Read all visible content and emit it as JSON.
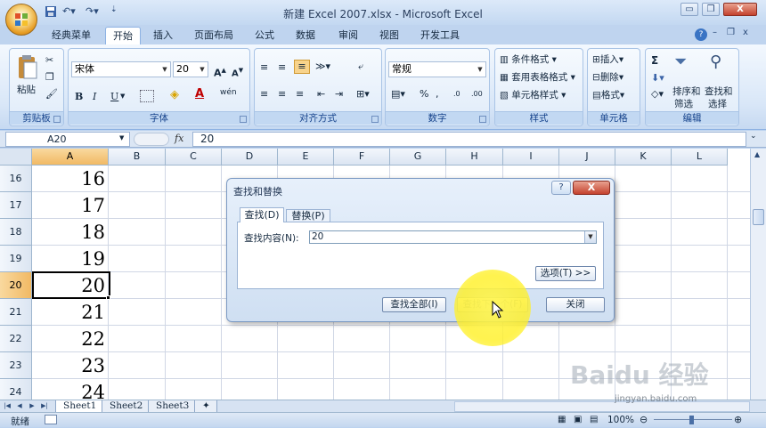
{
  "window": {
    "title": "新建 Excel 2007.xlsx - Microsoft Excel",
    "controls": [
      "minimize",
      "restore",
      "close"
    ]
  },
  "ribbon_tabs": [
    "经典菜单",
    "开始",
    "插入",
    "页面布局",
    "公式",
    "数据",
    "审阅",
    "视图",
    "开发工具"
  ],
  "active_tab": "开始",
  "ribbon": {
    "clipboard": {
      "paste": "粘贴",
      "label": "剪贴板"
    },
    "font": {
      "name": "宋体",
      "size": "20",
      "grow": "A",
      "shrink": "A",
      "bold": "B",
      "italic": "I",
      "underline": "U",
      "phonetic": "wén",
      "label": "字体"
    },
    "alignment": {
      "label": "对齐方式"
    },
    "number": {
      "format": "常规",
      "percent": "%",
      "comma": ",",
      "label": "数字",
      "inc_decimal": ".0",
      "dec_decimal": ".00"
    },
    "styles": {
      "conditional": "条件格式",
      "table": "套用表格格式",
      "cell_styles": "单元格样式",
      "label": "样式"
    },
    "cells": {
      "insert": "插入",
      "delete": "删除",
      "format": "格式",
      "label": "单元格"
    },
    "editing": {
      "sigma": "Σ",
      "sort": "排序和",
      "sort2": "筛选",
      "find": "查找和",
      "find2": "选择",
      "label": "编辑"
    }
  },
  "formula_bar": {
    "name_box": "A20",
    "fx": "fx",
    "value": "20"
  },
  "columns": [
    "A",
    "B",
    "C",
    "D",
    "E",
    "F",
    "G",
    "H",
    "I",
    "J",
    "K",
    "L"
  ],
  "selected_column": "A",
  "rows": [
    {
      "num": "16",
      "a": "16"
    },
    {
      "num": "17",
      "a": "17"
    },
    {
      "num": "18",
      "a": "18"
    },
    {
      "num": "19",
      "a": "19"
    },
    {
      "num": "20",
      "a": "20"
    },
    {
      "num": "21",
      "a": "21"
    },
    {
      "num": "22",
      "a": "22"
    },
    {
      "num": "23",
      "a": "23"
    },
    {
      "num": "24",
      "a": "24"
    }
  ],
  "selected_row": "20",
  "sheets": [
    "Sheet1",
    "Sheet2",
    "Sheet3"
  ],
  "active_sheet": "Sheet1",
  "status": {
    "mode": "就绪",
    "zoom": "100%"
  },
  "dialog": {
    "title": "查找和替换",
    "help": "?",
    "close": "X",
    "tab_find": "查找(D)",
    "tab_replace": "替换(P)",
    "find_label": "查找内容(N):",
    "find_value": "20",
    "options": "选项(T) >>",
    "find_all": "查找全部(I)",
    "find_next": "查找下一个(F)",
    "close_btn": "关闭"
  },
  "watermark": {
    "text": "Baidu 经验",
    "url": "jingyan.baidu.com"
  },
  "colors": {
    "accent": "#f1b964",
    "ribbon_blue": "#15428b",
    "highlight": "#fff250"
  }
}
